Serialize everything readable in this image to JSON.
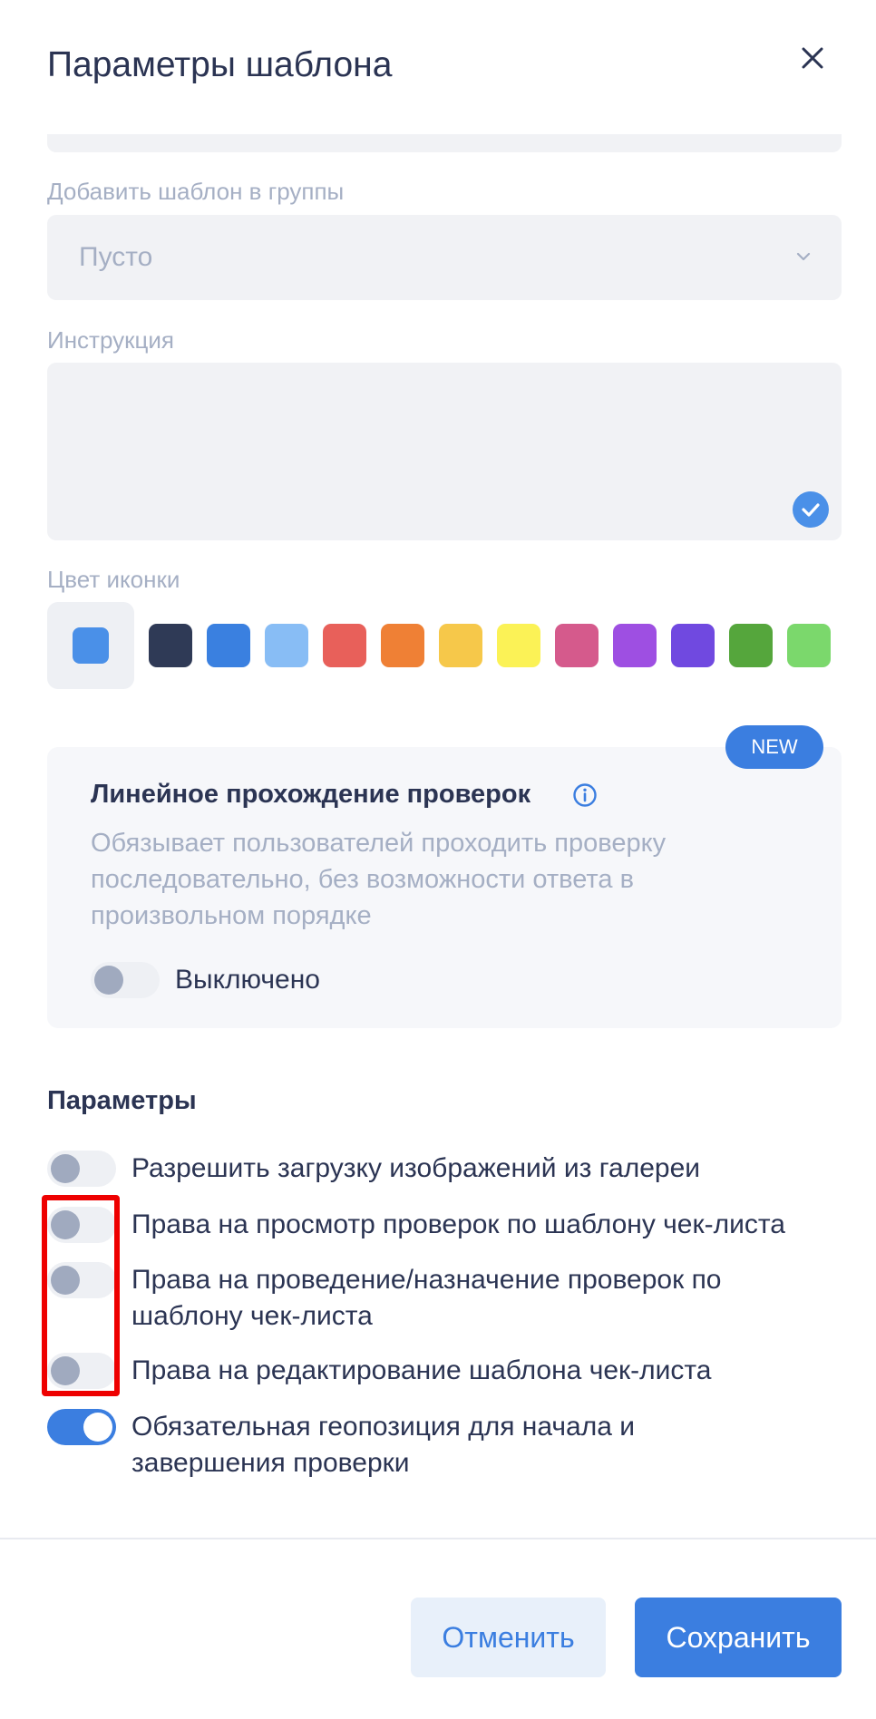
{
  "header": {
    "title": "Параметры шаблона",
    "close_icon": "close-icon"
  },
  "groups": {
    "label": "Добавить шаблон в группы",
    "placeholder": "Пусто"
  },
  "instruction": {
    "label": "Инструкция"
  },
  "icon_color": {
    "label": "Цвет иконки",
    "selected": "#4a90e8",
    "swatches": [
      "#2f3a56",
      "#3a80e0",
      "#88bdf5",
      "#e8605a",
      "#ef8035",
      "#f6c84a",
      "#fbf256",
      "#d55a8c",
      "#9e4fe2",
      "#7049e0",
      "#55a63c",
      "#7bd86c"
    ]
  },
  "linear": {
    "badge": "NEW",
    "title": "Линейное прохождение проверок",
    "description": "Обязывает пользователей проходить проверку последовательно, без возможности ответа в произвольном порядке",
    "toggle_label": "Выключено",
    "enabled": false
  },
  "params": {
    "title": "Параметры",
    "items": [
      {
        "label": "Разрешить загрузку изображений из галереи",
        "enabled": false
      },
      {
        "label": "Права на просмотр проверок по шаблону чек-листа",
        "enabled": false
      },
      {
        "label": "Права на проведение/назначение проверок по шаблону чек-листа",
        "enabled": false
      },
      {
        "label": "Права на редактирование шаблона чек-листа",
        "enabled": false
      },
      {
        "label": "Обязательная геопозиция для начала и завершения проверки",
        "enabled": true
      }
    ]
  },
  "footer": {
    "cancel_label": "Отменить",
    "save_label": "Сохранить"
  }
}
